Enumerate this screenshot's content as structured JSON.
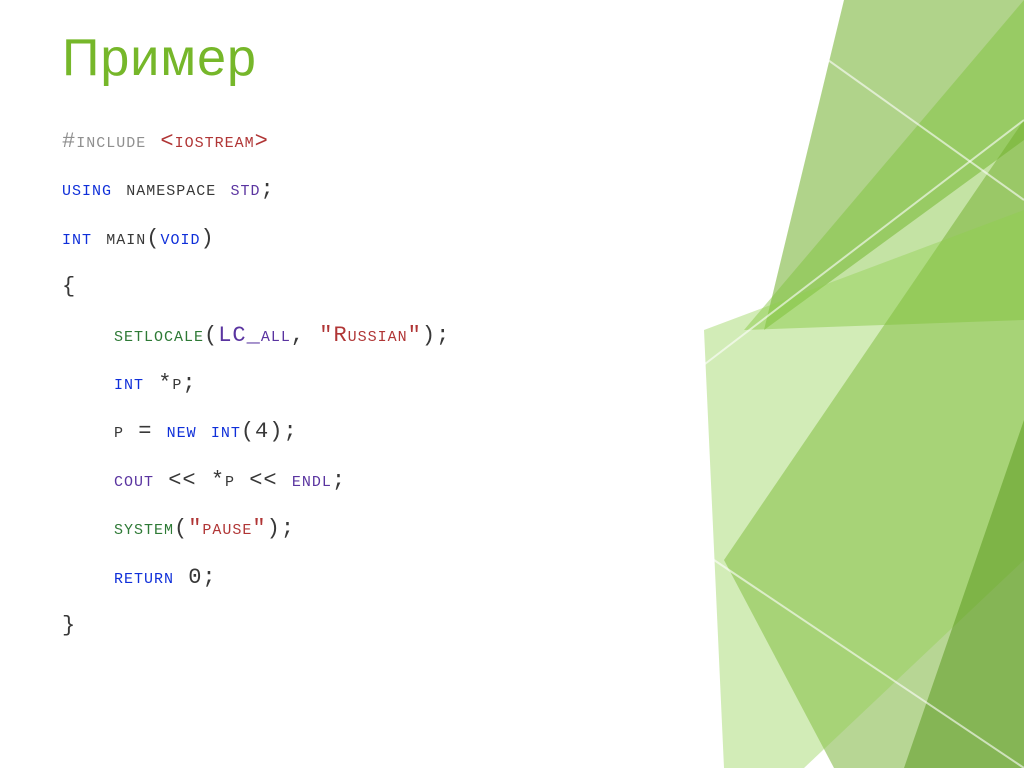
{
  "slide": {
    "title": "Пример",
    "code": {
      "l1": {
        "a": "#include ",
        "b": "<iostream>"
      },
      "l2": {
        "a": "using",
        "b": " namespace ",
        "c": "std",
        "d": ";"
      },
      "l3": "",
      "l4": {
        "a": "int",
        "b": " main(",
        "c": "void",
        "d": ")"
      },
      "l5": "{",
      "l6": {
        "a": "setlocale",
        "b": "(",
        "c": "LC_all",
        "d": ", ",
        "e": "\"Russian\"",
        "f": ");"
      },
      "l7": {
        "a": "int",
        "b": " *p;"
      },
      "l8": {
        "a": "p = ",
        "b": "new",
        "c": " ",
        "d": "int",
        "e": "(4);"
      },
      "l9": {
        "a": "cout",
        "b": " << *p << ",
        "c": "endl",
        "d": ";"
      },
      "l10": {
        "a": "system",
        "b": "(",
        "c": "\"pause\"",
        "d": ");"
      },
      "l11": {
        "a": "return",
        "b": " 0;"
      },
      "l12": "}"
    }
  }
}
